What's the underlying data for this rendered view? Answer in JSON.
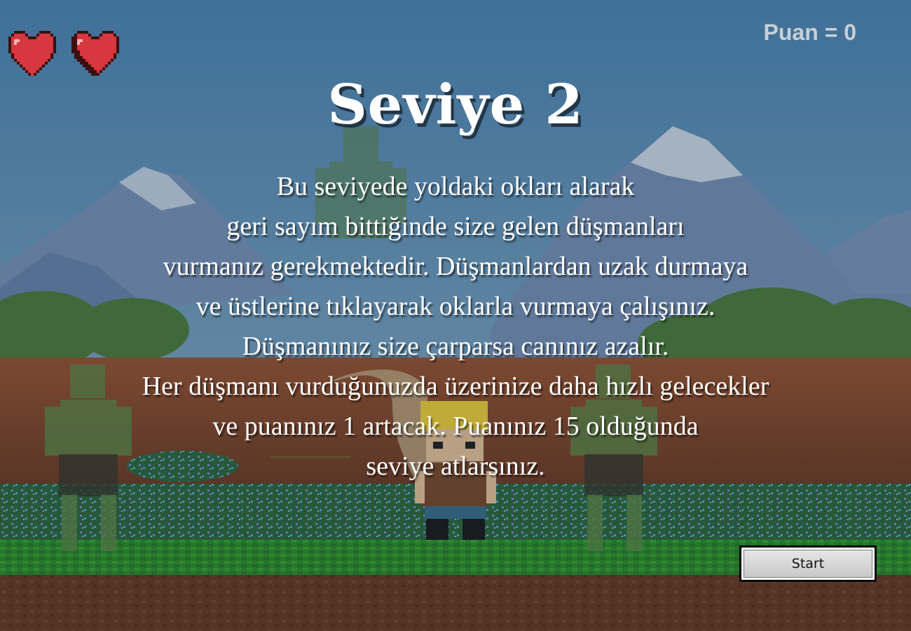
{
  "hud": {
    "lives": 2,
    "score_text": "Puan = 0"
  },
  "overlay": {
    "title": "Seviye 2",
    "lines": [
      "Bu seviyede yoldaki okları alarak",
      "geri sayım bittiğinde size gelen düşmanları",
      "vurmanız gerekmektedir. Düşmanlardan uzak durmaya",
      "ve üstlerine tıklayarak oklarla vurmaya çalışınız.",
      "Düşmanınız size çarparsa canınız azalır.",
      "Her düşmanı vurduğunuzda üzerinize daha hızlı gelecekler",
      "ve puanınız 1 artacak. Puanınız 15 olduğunda",
      "seviye atlarsınız."
    ],
    "start_label": "Start"
  },
  "colors": {
    "sky_top": "#4e87b4",
    "sky_bottom": "#8fb3c7",
    "mountain": "#6b8fb7",
    "snow": "#c9d6e6",
    "tree": "#4d7f3a",
    "ground": "#8a4a2a",
    "grass": "#2f8d2a",
    "heart": "#d7373e",
    "enemy": "#5f8a45",
    "hero_hair": "#f0d23a"
  },
  "icons": [
    "heart-icon",
    "heart-icon"
  ]
}
